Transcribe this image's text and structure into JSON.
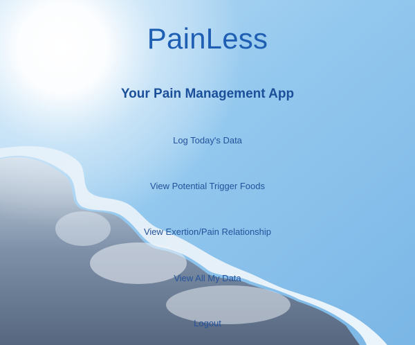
{
  "header": {
    "title": "PainLess",
    "subtitle": "Your Pain Management App"
  },
  "nav": {
    "items": [
      {
        "label": "Log Today's Data"
      },
      {
        "label": "View Potential Trigger Foods"
      },
      {
        "label": "View Exertion/Pain Relationship"
      },
      {
        "label": "View All My Data"
      },
      {
        "label": "Logout"
      }
    ]
  },
  "colors": {
    "title": "#1f5fb3",
    "subtitle": "#1c4f9a",
    "link": "#24529a",
    "sky": "#8cc2ec"
  }
}
